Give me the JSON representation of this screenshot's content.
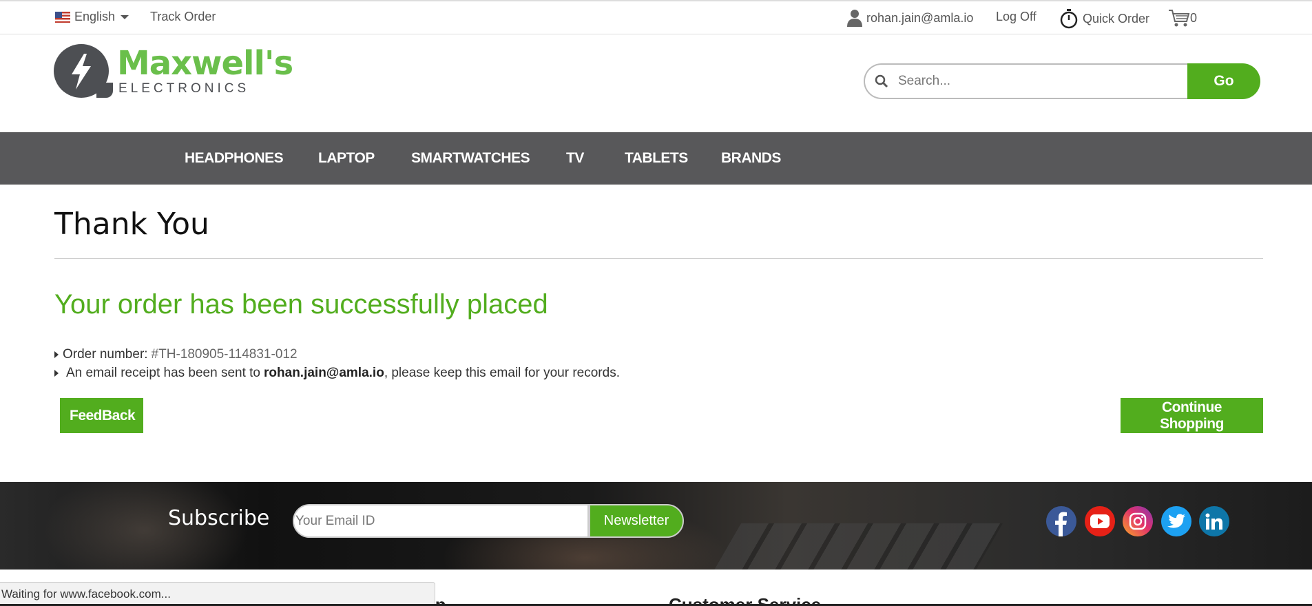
{
  "topbar": {
    "language": "English",
    "track_order": "Track Order",
    "user_email": "rohan.jain@amla.io",
    "log_off": "Log Off",
    "quick_order": "Quick Order",
    "cart_count": "0"
  },
  "header": {
    "logo_name": "Maxwell's",
    "logo_sub": "ELECTRONICS",
    "search_placeholder": "Search...",
    "go_label": "Go"
  },
  "nav": {
    "items": [
      "HEADPHONES",
      "LAPTOP",
      "SMARTWATCHES",
      "TV",
      "TABLETS",
      "BRANDS"
    ]
  },
  "main": {
    "title": "Thank You",
    "success_message": "Your order has been successfully placed",
    "order_label": "Order number:",
    "order_number": "#TH-180905-114831-012",
    "receipt_prefix": "An email receipt has been sent to",
    "receipt_email": "rohan.jain@amla.io",
    "receipt_suffix": ", please keep this email for your records.",
    "feedback_label": "FeedBack",
    "continue_label": "Continue Shopping"
  },
  "subscribe": {
    "title": "Subscribe",
    "email_placeholder": "Your Email ID",
    "button_label": "Newsletter"
  },
  "social": {
    "icons": [
      "facebook-icon",
      "youtube-icon",
      "instagram-icon",
      "twitter-icon",
      "linkedin-icon"
    ],
    "colors": {
      "facebook": "#3b5998",
      "youtube": "#e62117",
      "instagram": "#c13584",
      "twitter": "#1da1f2",
      "linkedin": "#0e76a8"
    }
  },
  "footer": {
    "col2_heading_partial": "tion",
    "col3_heading_partial": "Customer Service"
  },
  "status_bar": "Waiting for www.facebook.com...",
  "colors": {
    "accent": "#52ad1e",
    "nav_bg": "#58585a",
    "logo_green": "#6abf4b",
    "logo_gray": "#4d4f53"
  }
}
